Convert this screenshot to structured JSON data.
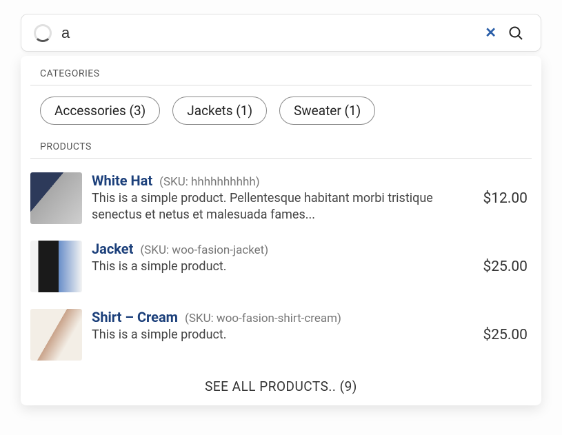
{
  "search": {
    "value": "a",
    "placeholder": ""
  },
  "sections": {
    "categories_label": "CATEGORIES",
    "products_label": "PRODUCTS"
  },
  "categories": [
    {
      "label": "Accessories (3)"
    },
    {
      "label": "Jackets (1)"
    },
    {
      "label": "Sweater (1)"
    }
  ],
  "products": [
    {
      "title": "White Hat",
      "sku": "(SKU: hhhhhhhhhh)",
      "desc": "This is a simple product. Pellentesque habitant morbi tristique senectus et netus et malesuada fames...",
      "price": "$12.00"
    },
    {
      "title": "Jacket",
      "sku": "(SKU: woo-fasion-jacket)",
      "desc": "This is a simple product.",
      "price": "$25.00"
    },
    {
      "title": "Shirt – Cream",
      "sku": "(SKU: woo-fasion-shirt-cream)",
      "desc": "This is a simple product.",
      "price": "$25.00"
    }
  ],
  "see_all": "SEE ALL PRODUCTS.. (9)"
}
